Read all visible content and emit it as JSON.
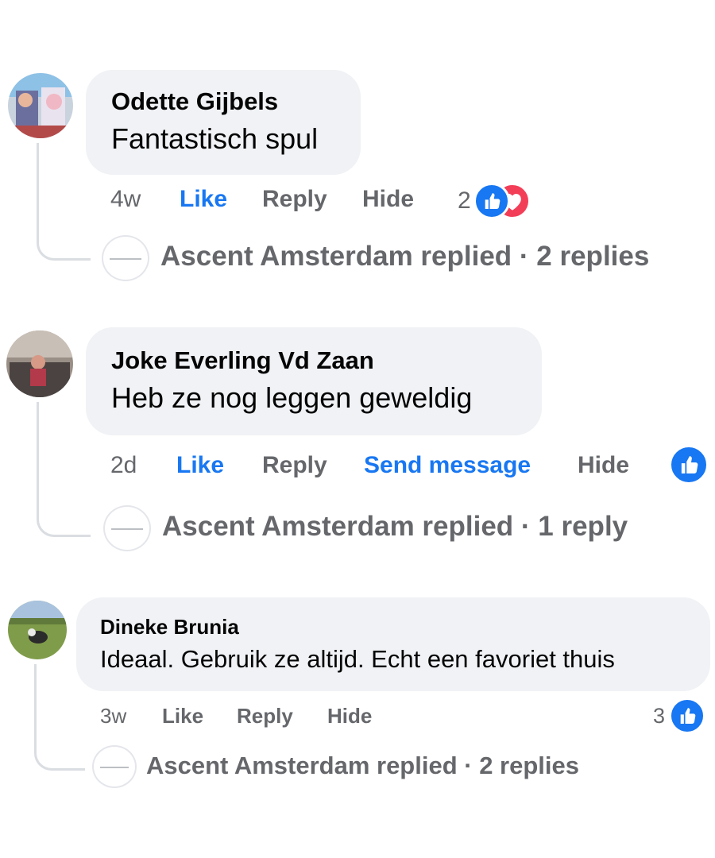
{
  "comments": [
    {
      "author": "Odette Gijbels",
      "text": "Fantastisch spul",
      "time": "4w",
      "actions": {
        "like": "Like",
        "reply": "Reply",
        "hide": "Hide"
      },
      "reaction_count": "2",
      "reactions": [
        "like-icon",
        "love-icon"
      ],
      "replies_summary": "Ascent Amsterdam replied · 2 replies"
    },
    {
      "author": "Joke Everling Vd Zaan",
      "text": "Heb ze nog leggen geweldig",
      "time": "2d",
      "actions": {
        "like": "Like",
        "reply": "Reply",
        "send_message": "Send message",
        "hide": "Hide"
      },
      "reactions": [
        "like-icon"
      ],
      "replies_summary": "Ascent Amsterdam replied · 1 reply"
    },
    {
      "author": "Dineke Brunia",
      "text": "Ideaal. Gebruik ze altijd. Echt een favoriet thuis",
      "time": "3w",
      "actions": {
        "like": "Like",
        "reply": "Reply",
        "hide": "Hide"
      },
      "reaction_count": "3",
      "reactions": [
        "like-icon"
      ],
      "replies_summary": "Ascent Amsterdam replied · 2 replies"
    }
  ],
  "colors": {
    "link_blue": "#1877f2",
    "muted_text": "#65676b",
    "bubble_bg": "#f0f2f5",
    "love_red": "#f33e58"
  }
}
